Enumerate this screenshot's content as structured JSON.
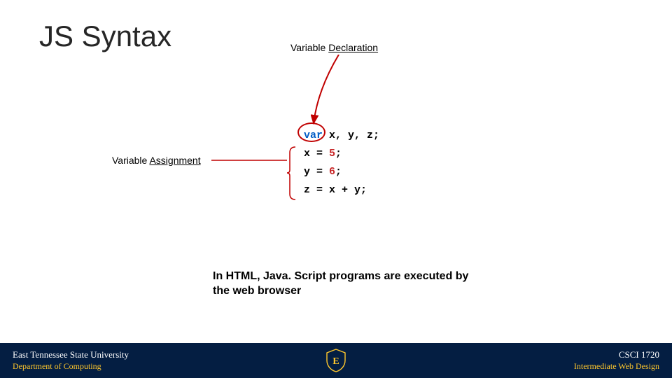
{
  "title": "JS Syntax",
  "labels": {
    "declaration_prefix": "Variable ",
    "declaration_word": "Declaration",
    "assignment_prefix": "Variable ",
    "assignment_word": "Assignment"
  },
  "code": {
    "var_kw": "var",
    "decl_rest": " x, y, z;",
    "line2_a": "x = ",
    "line2_num": "5",
    "line2_b": ";",
    "line3_a": "y = ",
    "line3_num": "6",
    "line3_b": ";",
    "line4": "z = x + y;"
  },
  "description": "In HTML, Java. Script programs are executed by the web browser",
  "footer": {
    "university": "East Tennessee State University",
    "department": "Department of Computing",
    "course_code": "CSCI 1720",
    "course_name": "Intermediate Web Design",
    "logo_letter": "E"
  },
  "colors": {
    "footer_bg": "#041e42",
    "accent_gold": "#ffc72c",
    "annotation_red": "#c00000",
    "keyword_blue": "#005cc5",
    "number_red": "#c82829"
  }
}
